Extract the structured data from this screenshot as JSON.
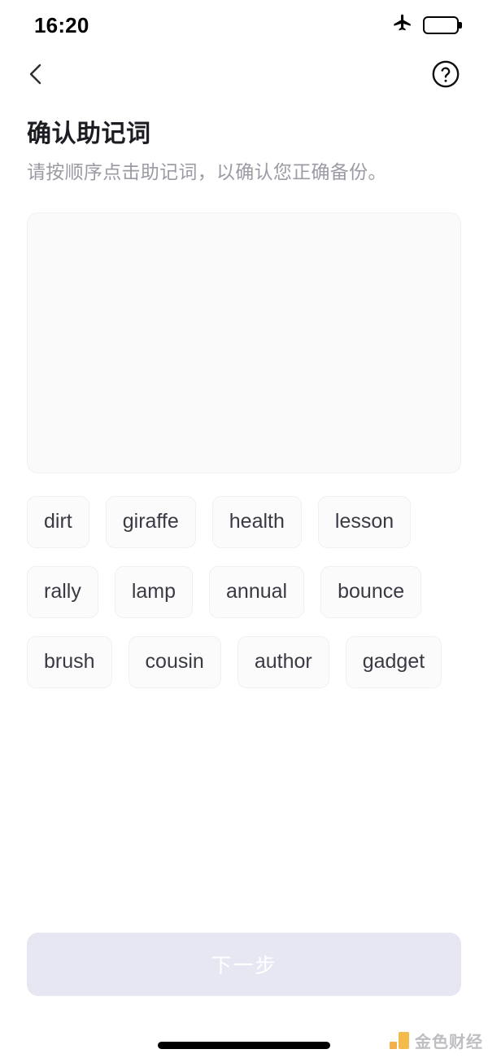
{
  "status_bar": {
    "time": "16:20",
    "airplane_icon": "airplane-mode-icon",
    "battery_icon": "battery-icon",
    "battery_level_percent": 50,
    "battery_color": "#f7c51e"
  },
  "nav": {
    "back_icon": "chevron-left-icon",
    "help_icon": "question-mark-circle-icon"
  },
  "header": {
    "title": "确认助记词",
    "subtitle": "请按顺序点击助记词，以确认您正确备份。"
  },
  "drop_zone": {
    "selected_words": []
  },
  "word_pool": {
    "words": [
      "dirt",
      "giraffe",
      "health",
      "lesson",
      "rally",
      "lamp",
      "annual",
      "bounce",
      "brush",
      "cousin",
      "author",
      "gadget"
    ]
  },
  "footer": {
    "next_label": "下一步",
    "next_enabled": false,
    "next_disabled_bg": "#e7e7f4"
  },
  "watermark": {
    "text": "金色财经",
    "logo_color": "#f2b63c"
  }
}
